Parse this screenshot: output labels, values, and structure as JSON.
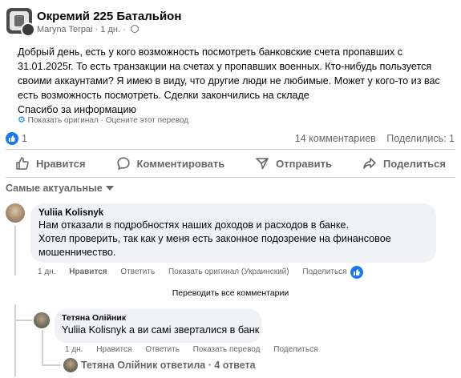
{
  "post": {
    "group_name": "Окремий 225 Батальйон",
    "author": "Maryna Terpai",
    "time": "1 дн.",
    "separator": "·",
    "text_lines": [
      "Добрый день, есть у кого возможность посмотреть банковские счета пропавших с",
      "31.01.2025г. То есть транзакции на счетах у пропавших военных. Кто-нибудь пользуется",
      "своими аккаунтами? Я имею в виду, что другие люди не любимые. Может у кого-то из вас",
      "есть возможность посмотреть. Сделки закончились на складе",
      "Спасибо за информацию"
    ],
    "show_original": "Показать оригинал",
    "rate_translation": "Оцените этот перевод"
  },
  "reactions": {
    "like_count": "1",
    "comments": "14 комментариев",
    "shares": "Поделились: 1"
  },
  "actions": {
    "like": "Нравится",
    "comment": "Комментировать",
    "send": "Отправить",
    "share": "Поделиться"
  },
  "sort": {
    "label": "Самые актуальные"
  },
  "comment1": {
    "author": "Yuliia Kolisnyk",
    "text_lines": [
      "Нам отказали в подробностях наших доходов и расходов в банке.",
      "Хотел проверить, так как у меня есть законное подозрение на финансовое",
      "мошенничество."
    ],
    "time": "1 дн.",
    "like": "Нравится",
    "reply": "Ответить",
    "show_original": "Показать оригинал (Украинский)",
    "share": "Поделиться"
  },
  "translate_all": "Переводить все комментарии",
  "comment2": {
    "author": "Тетяна Олійник",
    "mention": "Yuliia Kolisnyk",
    "text": " а ви самі зверталися в банк",
    "time": "1 дн.",
    "like": "Нравится",
    "reply": "Ответить",
    "show_translation": "Показать перевод",
    "share": "Поделиться"
  },
  "replies": {
    "label": "Тетяна Олійник ответила · 4 ответа"
  },
  "colors": {
    "accent": "#1877f2",
    "secondary_text": "#65676b",
    "bubble": "#f0f2f5"
  }
}
